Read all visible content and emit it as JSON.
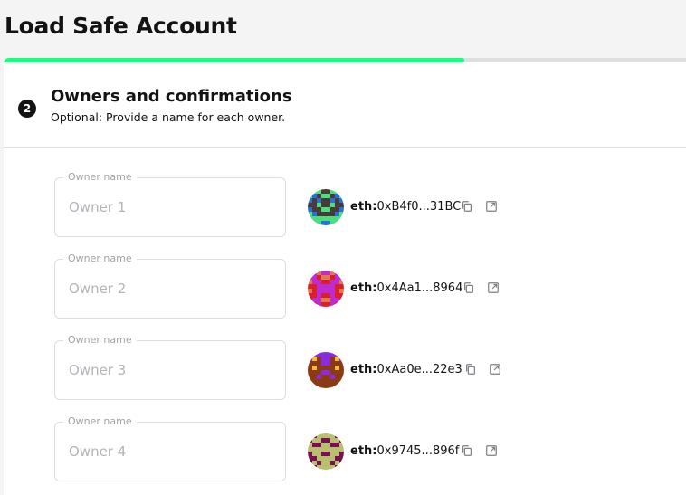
{
  "page": {
    "title": "Load Safe Account"
  },
  "progress": {
    "fraction": 0.67,
    "color": "#12ff80"
  },
  "step": {
    "number": "2",
    "title": "Owners and confirmations",
    "subtitle": "Optional: Provide a name for each owner."
  },
  "owners": [
    {
      "label": "Owner name",
      "placeholder": "Owner 1",
      "value": "",
      "prefix": "eth:",
      "address": "0xB4f0...31BC",
      "avatar_colors": [
        "#2d6fd8",
        "#47e07a",
        "#4b3a3a"
      ]
    },
    {
      "label": "Owner name",
      "placeholder": "Owner 2",
      "value": "",
      "prefix": "eth:",
      "address": "0x4Aa1...8964",
      "avatar_colors": [
        "#d8202c",
        "#c02bd0",
        "#e07a4a"
      ]
    },
    {
      "label": "Owner name",
      "placeholder": "Owner 3",
      "value": "",
      "prefix": "eth:",
      "address": "0xAa0e...22e3",
      "avatar_colors": [
        "#8a2be2",
        "#8b3a14",
        "#f2b84a"
      ]
    },
    {
      "label": "Owner name",
      "placeholder": "Owner 4",
      "value": "",
      "prefix": "eth:",
      "address": "0x9745...896f",
      "avatar_colors": [
        "#7a1050",
        "#b8c070",
        "#5a0a3a"
      ]
    }
  ],
  "icons": {
    "copy": "copy-icon",
    "external": "external-link-icon"
  }
}
